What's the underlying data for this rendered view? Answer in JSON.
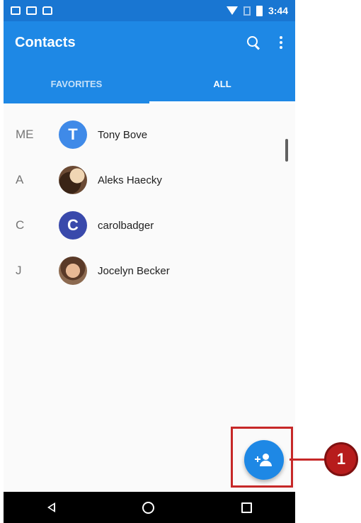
{
  "status_bar": {
    "time": "3:44",
    "left_icons": [
      "notification-icon",
      "mail-icon",
      "photo-icon"
    ],
    "right_icons": [
      "wifi-icon",
      "sim-icon",
      "battery-icon"
    ]
  },
  "toolbar": {
    "title": "Contacts",
    "actions": [
      "search-icon",
      "more-options-icon"
    ]
  },
  "tabs": [
    {
      "label": "FAVORITES",
      "active": false
    },
    {
      "label": "ALL",
      "active": true
    }
  ],
  "contacts": [
    {
      "section": "ME",
      "name": "Tony Bove",
      "avatar_letter": "T",
      "avatar_color": "#3f8ae8"
    },
    {
      "section": "A",
      "name": "Aleks Haecky",
      "avatar_letter": "",
      "avatar_color": ""
    },
    {
      "section": "C",
      "name": "carolbadger",
      "avatar_letter": "C",
      "avatar_color": "#3949ab"
    },
    {
      "section": "J",
      "name": "Jocelyn Becker",
      "avatar_letter": "",
      "avatar_color": ""
    }
  ],
  "fab": {
    "icon": "add-contact-icon",
    "color": "#1e88e5"
  },
  "callout": {
    "number": "1",
    "color": "#b71c1c"
  },
  "nav_bar": {
    "buttons": [
      "back-icon",
      "home-icon",
      "recents-icon"
    ]
  },
  "colors": {
    "primary": "#1e88e5",
    "status_bar": "#1976d2",
    "highlight": "#c62828"
  }
}
